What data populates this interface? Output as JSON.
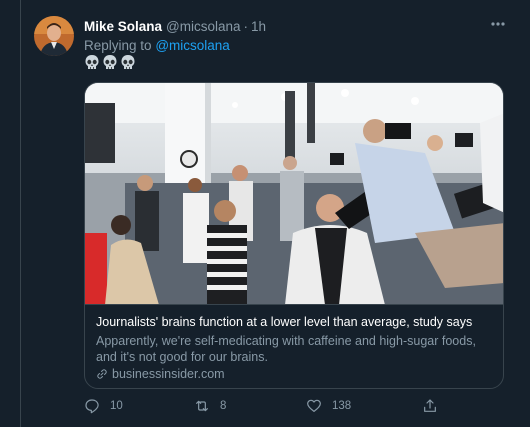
{
  "tweet": {
    "display_name": "Mike Solana",
    "handle": "@micsolana",
    "separator": "·",
    "time": "1h",
    "replying_prefix": "Replying to",
    "replying_to": "@micsolana",
    "emoji": [
      "skull",
      "skull",
      "skull"
    ]
  },
  "card": {
    "title": "Journalists' brains function at a lower level than average, study says",
    "description": "Apparently, we're self-medicating with caffeine and high-sugar foods, and it's not good for our brains.",
    "domain": "businessinsider.com"
  },
  "actions": {
    "reply_count": "10",
    "retweet_count": "8",
    "like_count": "138"
  },
  "colors": {
    "background": "#15202b",
    "border": "#38444d",
    "secondary_text": "#8899a6",
    "accent": "#1da1f2"
  },
  "icons": [
    "more-icon",
    "link-icon",
    "reply-icon",
    "retweet-icon",
    "like-icon",
    "share-icon"
  ]
}
